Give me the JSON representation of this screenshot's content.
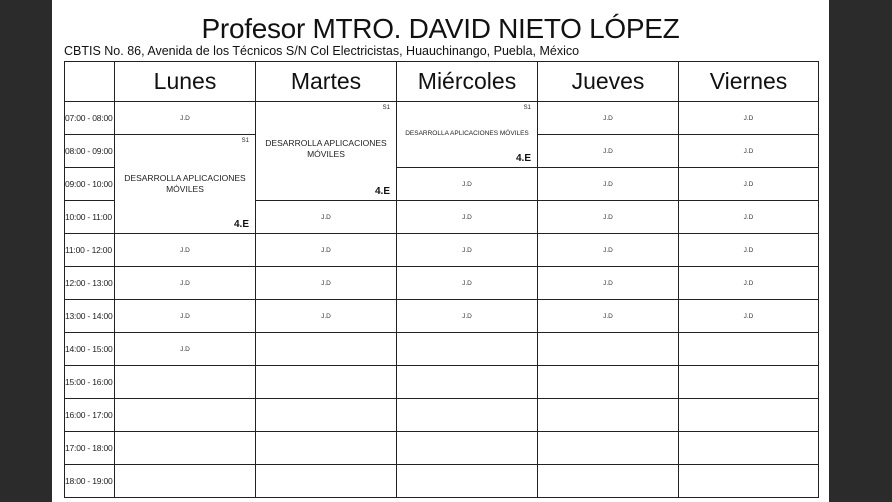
{
  "header": {
    "title": "Profesor MTRO. DAVID NIETO LÓPEZ",
    "address": "CBTIS No. 86, Avenida de los Técnicos S/N Col Electricistas, Huauchinango, Puebla, México"
  },
  "schedule": {
    "days": [
      "Lunes",
      "Martes",
      "Miércoles",
      "Jueves",
      "Viernes"
    ],
    "times": [
      "07:00 - 08:00",
      "08:00 - 09:00",
      "09:00 - 10:00",
      "10:00 - 11:00",
      "11:00 - 12:00",
      "12:00 - 13:00",
      "13:00 - 14:00",
      "14:00 - 15:00",
      "15:00 - 16:00",
      "16:00 - 17:00",
      "17:00 - 18:00",
      "18:00 - 19:00"
    ],
    "jd_label": "J.D",
    "class_monday": {
      "subject": "DESARROLLA APLICACIONES MÓVILES",
      "room": "S1",
      "group": "4.E"
    },
    "class_tuesday": {
      "subject": "DESARROLLA APLICACIONES MÓVILES",
      "room": "S1",
      "group": "4.E"
    },
    "class_wednesday": {
      "subject": "DESARROLLA APLICACIONES MÓVILES",
      "room": "S1",
      "group": "4.E"
    }
  }
}
